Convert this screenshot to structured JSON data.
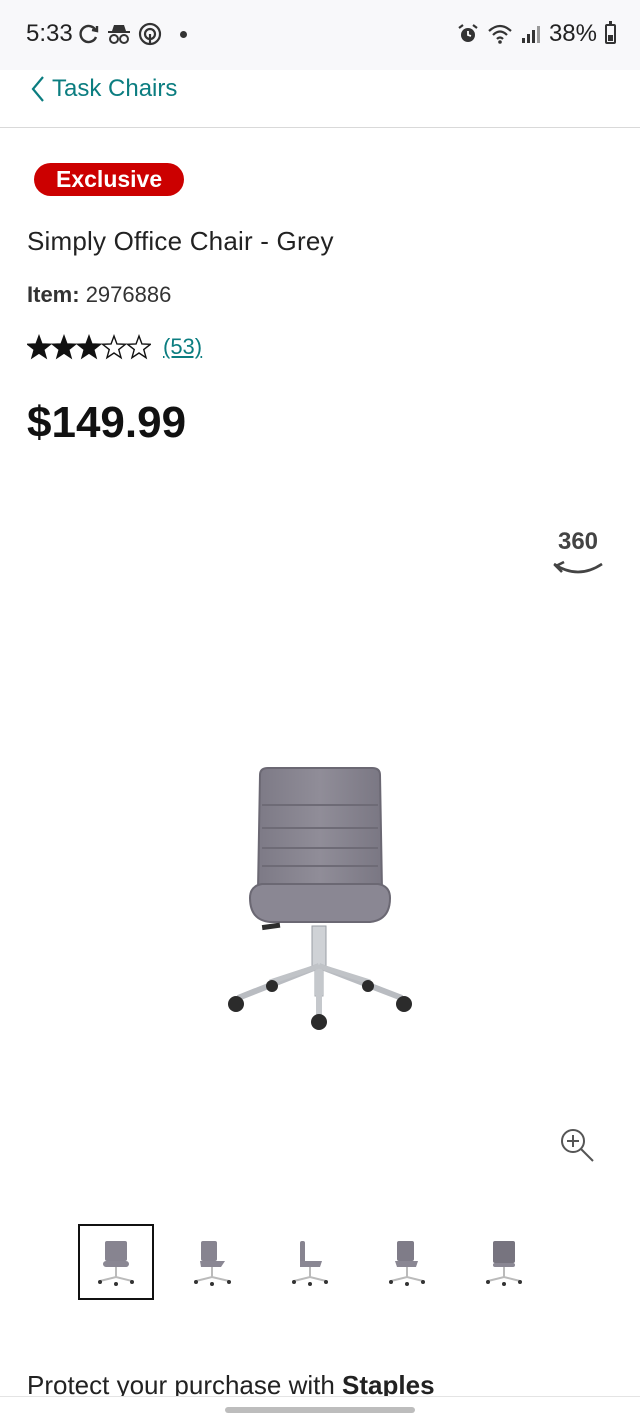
{
  "status_bar": {
    "time": "5:33",
    "battery_percent": "38%",
    "icons": [
      "sync-icon",
      "incognito-icon",
      "data-saver-icon",
      "dot-icon",
      "alarm-icon",
      "wifi-icon",
      "signal-icon",
      "battery-icon"
    ]
  },
  "nav": {
    "back_label": "Task Chairs",
    "back_icon": "chevron-left-icon"
  },
  "product": {
    "badge": "Exclusive",
    "title": "Simply Office Chair - Grey",
    "item_label": "Item:",
    "item_number": "2976886",
    "rating": 3,
    "rating_max": 5,
    "review_count": "(53)",
    "price": "$149.99"
  },
  "viewer": {
    "label_360": "360",
    "zoom_icon": "zoom-in-icon",
    "thumbnails_count": 5,
    "active_thumbnail": 1
  },
  "protect": {
    "prefix": "Protect your purchase with ",
    "brand": "Staples"
  },
  "colors": {
    "accent": "#0b7d80",
    "badge": "#cc0000",
    "text": "#1a1a1a"
  }
}
